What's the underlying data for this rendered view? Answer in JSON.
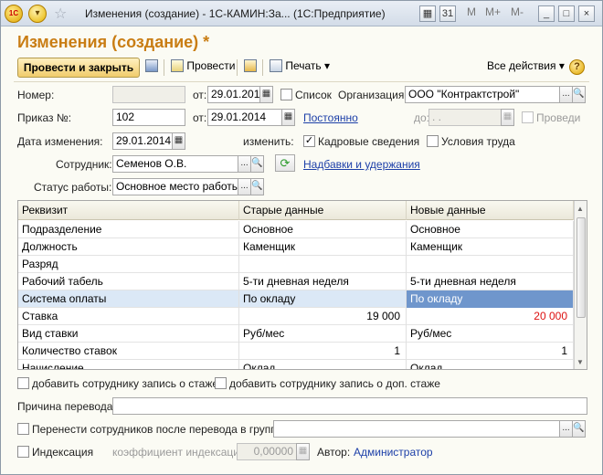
{
  "window": {
    "title": "Изменения (создание) - 1С-КАМИН:За... (1С:Предприятие)",
    "logo_text": "1С",
    "tb_m": "M",
    "tb_mplus": "M+",
    "tb_mminus": "M-",
    "min": "_",
    "max": "□",
    "close": "×"
  },
  "heading": "Изменения (создание) *",
  "toolbar": {
    "post_close": "Провести и закрыть",
    "post": "Провести",
    "print": "Печать",
    "all_actions": "Все действия",
    "help": "?"
  },
  "form": {
    "number_label": "Номер:",
    "number_value": "",
    "from_label": "от:",
    "number_date": "29.01.2014",
    "list_label": "Список",
    "org_label": "Организация:",
    "org_value": "ООО \"Контрактстрой\"",
    "order_label": "Приказ №:",
    "order_value": "102",
    "order_date": "29.01.2014",
    "permanent_link": "Постоянно",
    "until_label": "до:",
    "until_value": ". .",
    "posted_label": "Проведи",
    "change_date_label": "Дата изменения:",
    "change_date": "29.01.2014",
    "change_label": "изменить:",
    "personnel_label": "Кадровые сведения",
    "conditions_label": "Условия труда",
    "employee_label": "Сотрудник:",
    "employee_value": "Семенов О.В.",
    "allowances_link": "Надбавки и удержания",
    "work_status_label": "Статус работы:",
    "work_status_value": "Основное место работы"
  },
  "table": {
    "columns": [
      "Реквизит",
      "Старые данные",
      "Новые данные"
    ],
    "rows": [
      {
        "attr": "Подразделение",
        "old": "Основное",
        "new": "Основное"
      },
      {
        "attr": "Должность",
        "old": "Каменщик",
        "new": "Каменщик"
      },
      {
        "attr": "Разряд",
        "old": "",
        "new": ""
      },
      {
        "attr": "Рабочий табель",
        "old": "5-ти дневная неделя",
        "new": "5-ти дневная неделя"
      },
      {
        "attr": "Система оплаты",
        "old": "По окладу",
        "new": "По окладу"
      },
      {
        "attr": "Ставка",
        "old": "19 000",
        "new": "20 000"
      },
      {
        "attr": "Вид ставки",
        "old": "Руб/мес",
        "new": "Руб/мес"
      },
      {
        "attr": "Количество ставок",
        "old": "1",
        "new": "1"
      },
      {
        "attr": "Начисление",
        "old": "Оклад",
        "new": "Оклад"
      }
    ]
  },
  "bottom": {
    "add_exp_label": "добавить сотруднику запись о стаже",
    "add_extra_exp_label": "добавить сотруднику запись о доп. стаже",
    "reason_label": "Причина перевода:",
    "reason_value": "",
    "move_group_label": "Перенести сотрудников после перевода в группу",
    "move_group_value": "",
    "indexing_label": "Индексация",
    "coef_label": "коэффициент индексации:",
    "coef_value": "0,00000",
    "author_label": "Автор:",
    "author_value": "Администратор"
  },
  "icons": {
    "dots": "...",
    "search": "🔍",
    "calendar": "▦",
    "check": "✓",
    "dropdown": "▾",
    "refresh": "⟳",
    "up": "▲",
    "down": "▼"
  }
}
